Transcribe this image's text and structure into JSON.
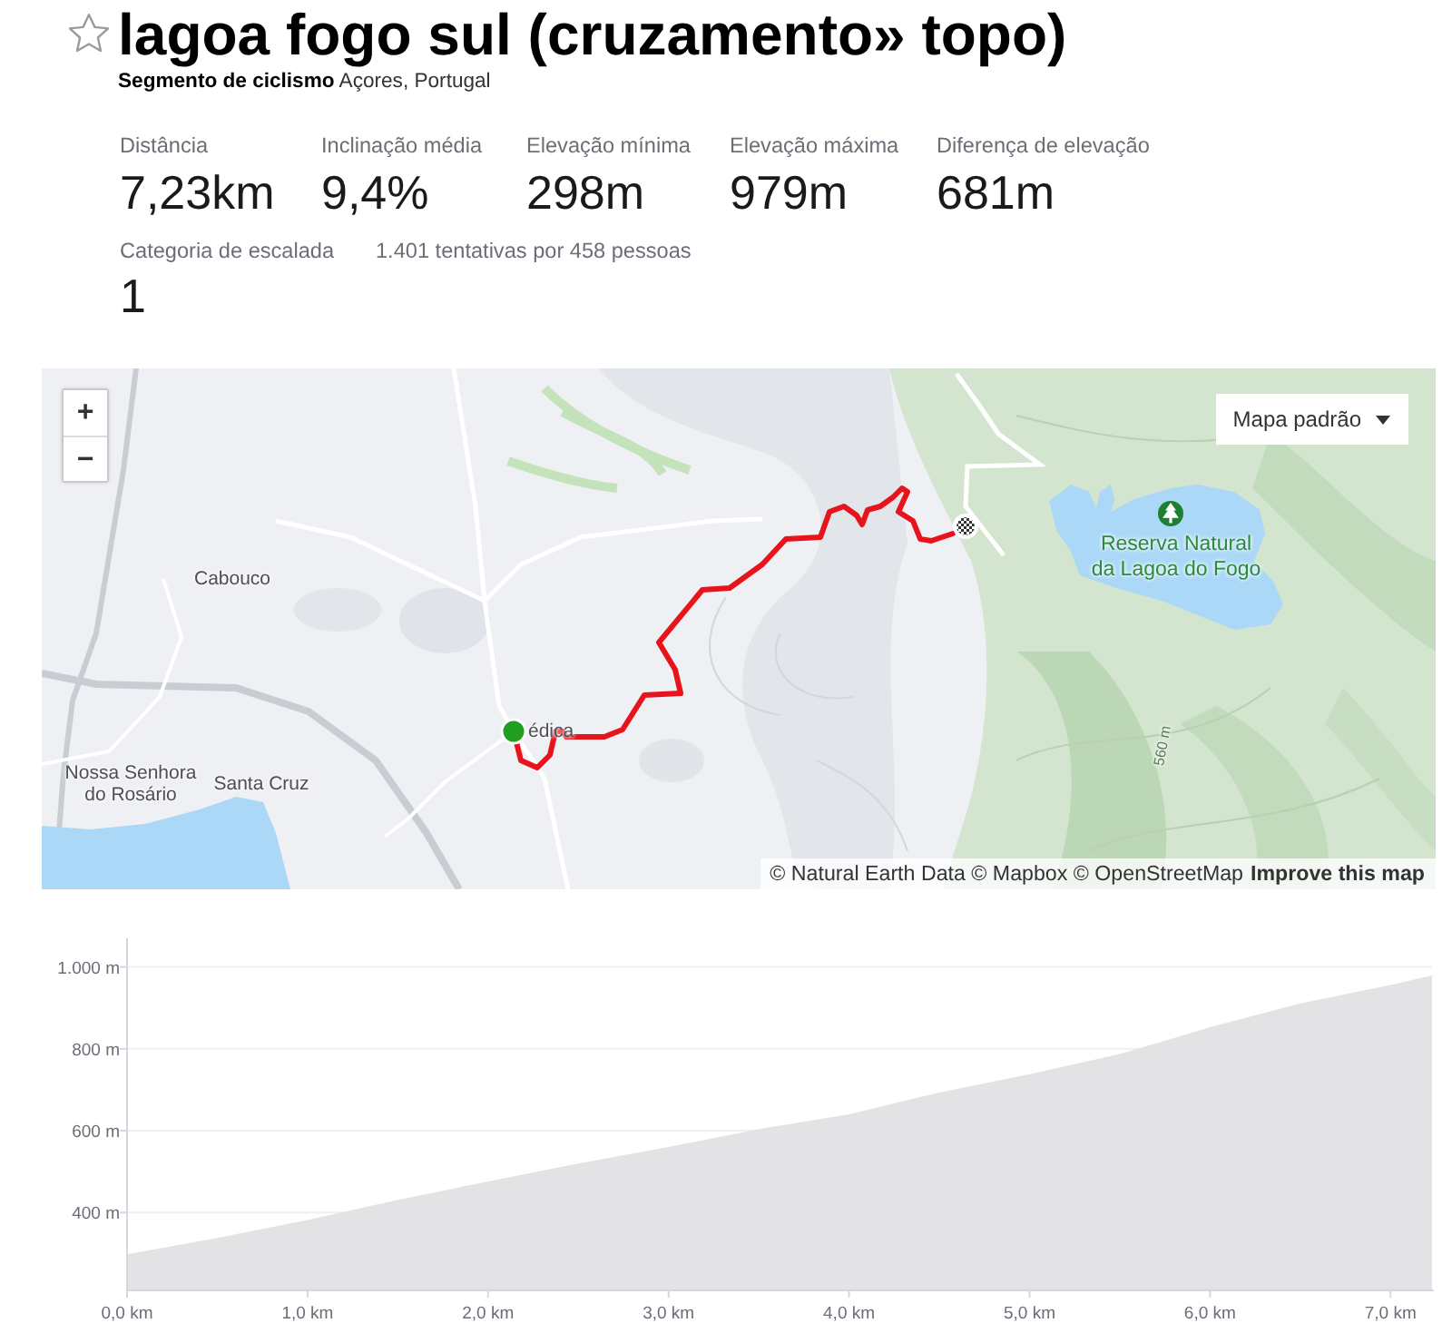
{
  "segment": {
    "starred": false,
    "title": "lagoa fogo sul (cruzamento» topo)",
    "subtitle": "**Segmento de ciclismo** Açores, Portugal"
  },
  "stats": [
    {
      "label": "Distância",
      "value": "7,23km"
    },
    {
      "label": "Inclinação média",
      "value": "9,4%"
    },
    {
      "label": "Elevação mínima",
      "value": "298m"
    },
    {
      "label": "Elevação máxima",
      "value": "979m"
    },
    {
      "label": "Diferença de elevação",
      "value": "681m"
    }
  ],
  "climb_category": {
    "label": "Categoria de escalada",
    "value": "1"
  },
  "attempts": "1.401 tentativas por 458 pessoas",
  "map": {
    "zoom_in": "+",
    "zoom_out": "−",
    "style_menu": "Mapa padrão",
    "labels": [
      {
        "kind": "place",
        "text": "Cabouco"
      },
      {
        "kind": "park",
        "text": "Reserva Natural\nda Lagoa do Fogo"
      },
      {
        "kind": "place",
        "text": "édica"
      },
      {
        "kind": "contour",
        "text": "560 m"
      },
      {
        "kind": "place",
        "text": "Nossa Senhora\ndo Rosário"
      },
      {
        "kind": "place",
        "text": "Santa Cruz"
      }
    ],
    "attribution": "© Natural Earth Data © Mapbox © OpenStreetMap",
    "improve_link": "Improve this map"
  },
  "elevation_profile": {
    "chart_data": {
      "type": "area",
      "x": [
        0,
        0.5,
        1,
        1.5,
        2,
        2.5,
        3,
        3.5,
        4,
        4.5,
        5,
        5.5,
        6,
        6.5,
        7,
        7.23
      ],
      "values": [
        298,
        338,
        382,
        431,
        476,
        520,
        560,
        604,
        640,
        693,
        738,
        787,
        853,
        911,
        956,
        979
      ],
      "xlim": [
        0,
        7.23
      ],
      "ylim": [
        210,
        1070
      ],
      "xticks": [
        {
          "value": 0,
          "label": "0,0 km"
        },
        {
          "value": 1,
          "label": "1,0 km"
        },
        {
          "value": 2,
          "label": "2,0 km"
        },
        {
          "value": 3,
          "label": "3,0 km"
        },
        {
          "value": 4,
          "label": "4,0 km"
        },
        {
          "value": 5,
          "label": "5,0 km"
        },
        {
          "value": 6,
          "label": "6,0 km"
        },
        {
          "value": 7,
          "label": "7,0 km"
        }
      ],
      "yticks": [
        {
          "value": 400,
          "label": "400 m"
        },
        {
          "value": 600,
          "label": "600 m"
        },
        {
          "value": 800,
          "label": "800 m"
        },
        {
          "value": 1000,
          "label": "1.000 m"
        }
      ],
      "grid": true
    }
  }
}
